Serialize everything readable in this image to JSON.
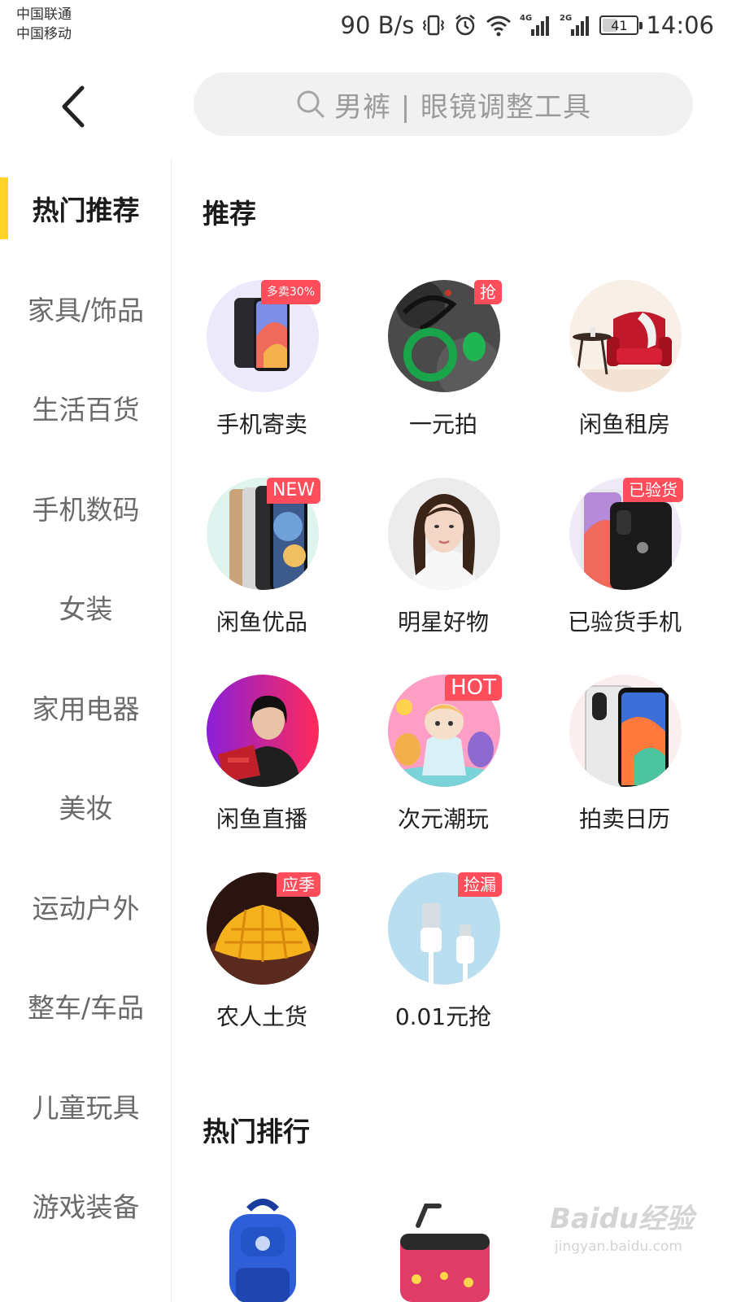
{
  "status_bar": {
    "carrier_1": "中国联通",
    "carrier_2": "中国移动",
    "net_speed": "90 B/s",
    "signal_1_type": "4G",
    "signal_2_type": "2G",
    "battery": "41",
    "time": "14:06"
  },
  "header": {
    "back_icon": "chevron-left-icon",
    "search_icon": "search-icon",
    "search_placeholder": "男裤 | 眼镜调整工具"
  },
  "sidebar": {
    "active_index": 0,
    "accent_color": "#ffd426",
    "items": [
      {
        "label": "热门推荐"
      },
      {
        "label": "家具/饰品"
      },
      {
        "label": "生活百货"
      },
      {
        "label": "手机数码"
      },
      {
        "label": "女装"
      },
      {
        "label": "家用电器"
      },
      {
        "label": "美妆"
      },
      {
        "label": "运动户外"
      },
      {
        "label": "整车/车品"
      },
      {
        "label": "儿童玩具"
      },
      {
        "label": "游戏装备"
      }
    ]
  },
  "main": {
    "section_recommend": "推荐",
    "section_ranking": "热门排行",
    "badge_color": "#ff4d5b",
    "categories": [
      {
        "label": "手机寄卖",
        "badge": "多卖30%",
        "image": "iphone-x-image"
      },
      {
        "label": "一元拍",
        "badge": "抢",
        "image": "jade-bracelet-image"
      },
      {
        "label": "闲鱼租房",
        "badge": "",
        "image": "red-armchair-image"
      },
      {
        "label": "闲鱼优品",
        "badge": "NEW",
        "image": "iphone-xs-image"
      },
      {
        "label": "明星好物",
        "badge": "",
        "image": "celebrity-portrait-image"
      },
      {
        "label": "已验货手机",
        "badge": "已验货",
        "image": "verified-iphone-image"
      },
      {
        "label": "闲鱼直播",
        "badge": "",
        "image": "live-streamer-image"
      },
      {
        "label": "次元潮玩",
        "badge": "HOT",
        "image": "designer-toy-image"
      },
      {
        "label": "拍卖日历",
        "badge": "",
        "image": "auction-iphone-image"
      },
      {
        "label": "农人土货",
        "badge": "应季",
        "image": "mango-image"
      },
      {
        "label": "0.01元抢",
        "badge": "捡漏",
        "image": "usb-cable-image"
      }
    ],
    "ranking_images": [
      "backpack-image",
      "ride-on-suitcase-image"
    ]
  },
  "watermark": {
    "logo": "Baidu经验",
    "url": "jingyan.baidu.com"
  }
}
